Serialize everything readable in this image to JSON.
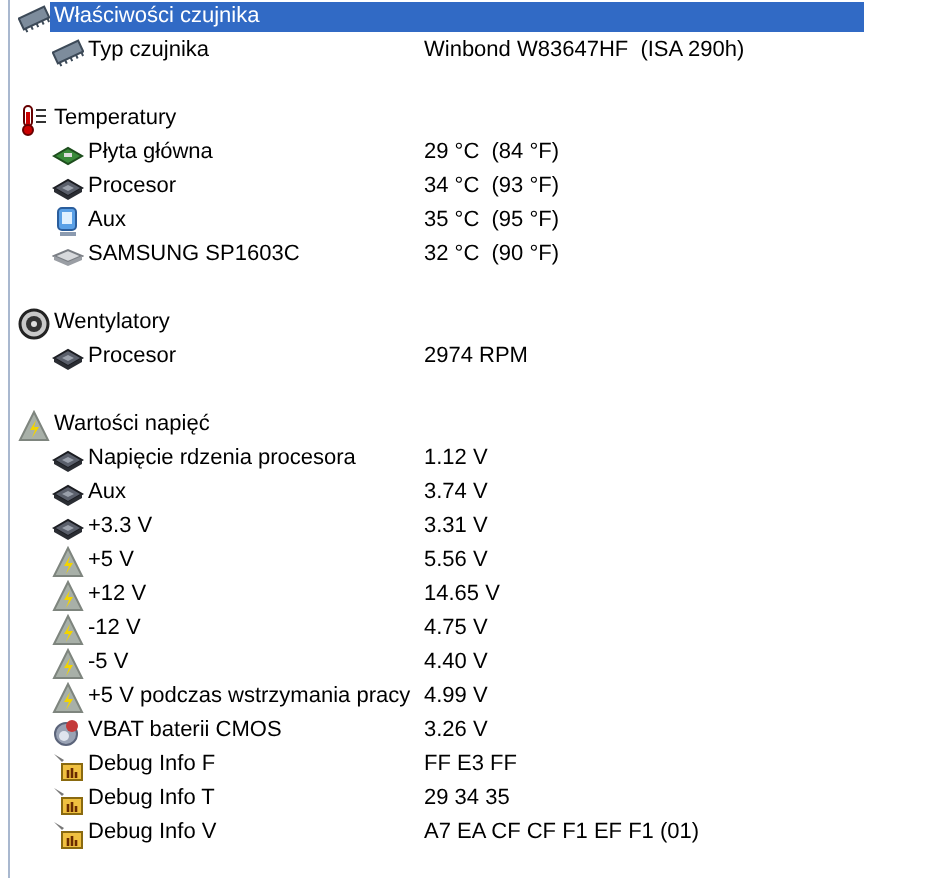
{
  "sections": [
    {
      "title": "Właściwości czujnika",
      "kind": "chip",
      "selected": true,
      "items": [
        {
          "kind": "chip",
          "label": "Typ czujnika",
          "value": "Winbond W83647HF  (ISA 290h)",
          "selected": false
        }
      ]
    },
    {
      "title": "Temperatury",
      "kind": "thermometer",
      "selected": false,
      "items": [
        {
          "kind": "board",
          "label": "Płyta główna",
          "value": "29 °C  (84 °F)",
          "selected": false
        },
        {
          "kind": "cpu",
          "label": "Procesor",
          "value": "34 °C  (93 °F)",
          "selected": false
        },
        {
          "kind": "monitor",
          "label": "Aux",
          "value": "35 °C  (95 °F)",
          "selected": false
        },
        {
          "kind": "disk",
          "label": "SAMSUNG SP1603C",
          "value": "32 °C  (90 °F)",
          "selected": false
        }
      ]
    },
    {
      "title": "Wentylatory",
      "kind": "fan",
      "selected": false,
      "items": [
        {
          "kind": "cpu",
          "label": "Procesor",
          "value": "2974 RPM",
          "selected": false
        }
      ]
    },
    {
      "title": "Wartości napięć",
      "kind": "voltage",
      "selected": false,
      "items": [
        {
          "kind": "cpu",
          "label": "Napięcie rdzenia procesora",
          "value": "1.12 V",
          "selected": false
        },
        {
          "kind": "cpu",
          "label": "Aux",
          "value": "3.74 V",
          "selected": false
        },
        {
          "kind": "cpu",
          "label": "+3.3 V",
          "value": "3.31 V",
          "selected": false
        },
        {
          "kind": "voltage",
          "label": "+5 V",
          "value": "5.56 V",
          "selected": false
        },
        {
          "kind": "voltage",
          "label": "+12 V",
          "value": "14.65 V",
          "selected": false
        },
        {
          "kind": "voltage",
          "label": "-12 V",
          "value": "4.75 V",
          "selected": false
        },
        {
          "kind": "voltage",
          "label": "-5 V",
          "value": "4.40 V",
          "selected": false
        },
        {
          "kind": "voltage",
          "label": "+5 V podczas wstrzymania pracy",
          "value": "4.99 V",
          "selected": false
        },
        {
          "kind": "battery",
          "label": "VBAT baterii CMOS",
          "value": "3.26 V",
          "selected": false
        },
        {
          "kind": "debug",
          "label": "Debug Info F",
          "value": "FF E3 FF",
          "selected": false
        },
        {
          "kind": "debug",
          "label": "Debug Info T",
          "value": "29 34 35",
          "selected": false
        },
        {
          "kind": "debug",
          "label": "Debug Info V",
          "value": "A7 EA CF CF F1 EF F1 (01)",
          "selected": false
        }
      ]
    }
  ]
}
